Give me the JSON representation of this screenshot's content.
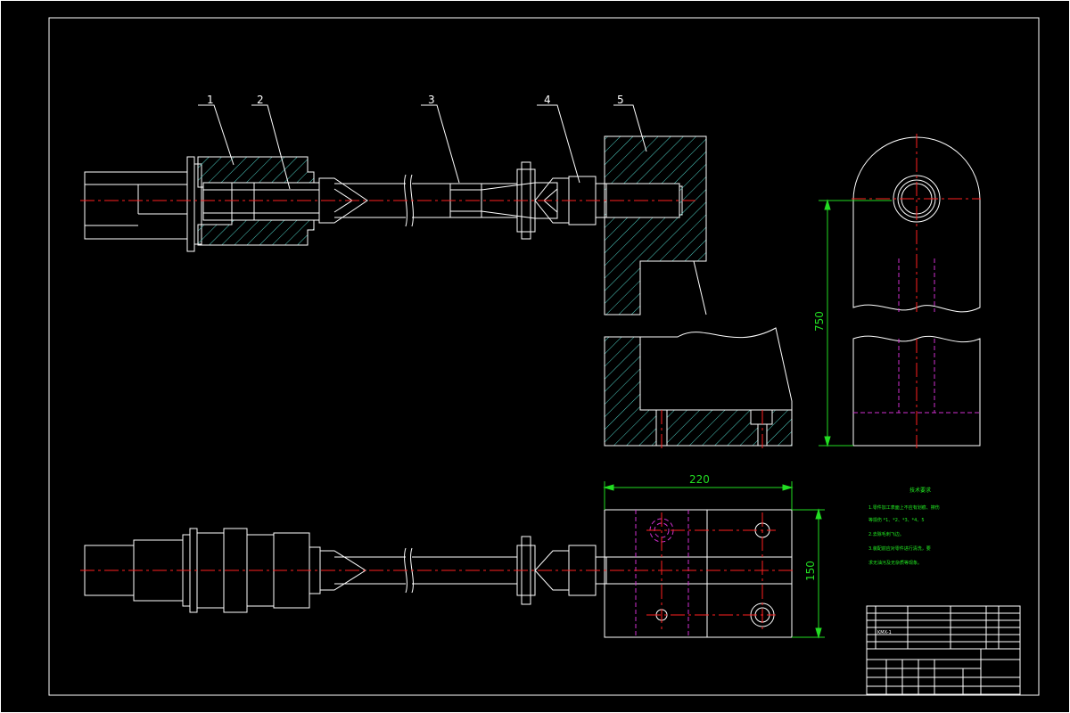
{
  "colors": {
    "background": "#000000",
    "outline": "#ffffff",
    "centerline": "#ff2020",
    "hatch": "#4fd1c5",
    "dimension": "#22dd22",
    "hidden": "#d030d0",
    "notes": "#22ee22"
  },
  "part_labels": [
    "1",
    "2",
    "3",
    "4",
    "5"
  ],
  "dimensions": {
    "height": "750",
    "width": "220",
    "depth": "150"
  },
  "notes": {
    "title": "技术要求",
    "lines": [
      "1.零件加工表面上不应有划痕、擦伤",
      "等损伤 *1、*2、*3、*4、5",
      "2.去除毛刺飞边。",
      "3.装配前应对零件进行清洗，要",
      "求无油污及无杂质等现象。"
    ]
  },
  "title_block": {
    "drawing_code": "KMX-1"
  }
}
